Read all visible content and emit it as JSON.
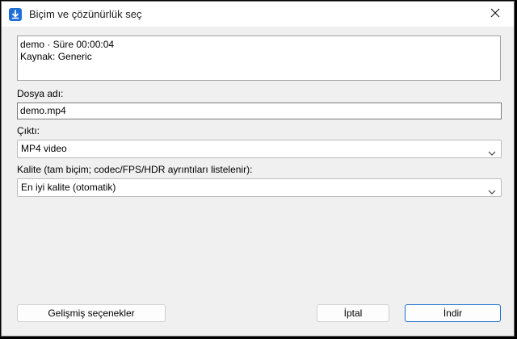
{
  "window": {
    "title": "Biçim ve çözünürlük seç"
  },
  "info": {
    "line1": "demo · Süre 00:00:04",
    "line2": "Kaynak: Generic"
  },
  "filename": {
    "label": "Dosya adı:",
    "value": "demo.mp4"
  },
  "output": {
    "label": "Çıktı:",
    "selected": "MP4 video"
  },
  "quality": {
    "label": "Kalite (tam biçim; codec/FPS/HDR ayrıntıları listelenir):",
    "selected": "En iyi kalite (otomatik)"
  },
  "buttons": {
    "advanced": "Gelişmiş seçenekler",
    "cancel": "İptal",
    "download": "İndir"
  },
  "icons": {
    "app": "download-icon",
    "close": "close-icon",
    "dropdown": "chevron-down-icon"
  },
  "colors": {
    "accent": "#1f6fd6",
    "primary_border": "#1a6fcf"
  }
}
